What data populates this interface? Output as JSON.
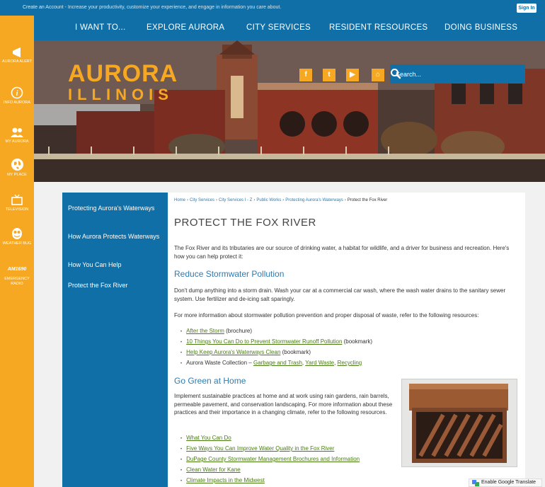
{
  "topbar": {
    "create_link": "Create an Account",
    "create_text": " - Increase your productivity, customize your experience, and engage in information you care about.",
    "signin": "Sign In"
  },
  "leftbar": {
    "items": [
      {
        "label": "AURORA ALERT",
        "icon": "megaphone-icon"
      },
      {
        "label": "INFO AURORA",
        "icon": "info-icon"
      },
      {
        "label": "MY AURORA",
        "icon": "people-icon"
      },
      {
        "label": "MY PLACE",
        "icon": "globe-icon"
      },
      {
        "label": "TELEVISION",
        "icon": "tv-icon"
      },
      {
        "label": "WEATHER BUG",
        "icon": "weatherbug-icon"
      },
      {
        "label": "EMERGENCY RADIO",
        "icon": "radio-icon",
        "logo_text": "AM1690"
      }
    ]
  },
  "nav": {
    "items": [
      "I WANT TO...",
      "EXPLORE AURORA",
      "CITY SERVICES",
      "RESIDENT RESOURCES",
      "DOING BUSINESS"
    ]
  },
  "hero": {
    "logo_line1": "AURORA",
    "logo_line2": "ILLINOIS",
    "social": [
      {
        "name": "facebook-icon",
        "glyph": "f"
      },
      {
        "name": "twitter-icon",
        "glyph": "t"
      },
      {
        "name": "youtube-icon",
        "glyph": "▶"
      },
      {
        "name": "home-icon",
        "glyph": "⌂"
      }
    ],
    "search_placeholder": "Search..."
  },
  "sidenav": {
    "items": [
      "Protecting Aurora's Waterways",
      "How Aurora Protects Waterways",
      "How You Can Help",
      "Protect the Fox River"
    ]
  },
  "breadcrumb": {
    "links": [
      "Home",
      "City Services",
      "City Services I - Z",
      "Public Works",
      "Protecting Aurora's Waterways"
    ],
    "current": "Protect the Fox River"
  },
  "main": {
    "title": "PROTECT THE FOX RIVER",
    "intro": "The Fox River and its tributaries are our source of drinking water, a habitat for wildlife, and a driver for business and recreation. Here's how you can help protect it:",
    "section1": {
      "heading": "Reduce Stormwater Pollution",
      "p1": "Don't dump anything into a storm drain. Wash your car at a commercial car wash, where the wash water drains to the sanitary sewer system. Use fertilizer and de-icing salt sparingly.",
      "p2": "For more information about stormwater pollution prevention and proper disposal of waste, refer to the following resources:",
      "links": [
        {
          "text": "After the Storm",
          "suffix": " (brochure)"
        },
        {
          "text": "10 Things You Can Do to Prevent Stormwater Runoff Pollution",
          "suffix": " (bookmark)"
        },
        {
          "text": "Help Keep Aurora's Waterways Clean",
          "suffix": " (bookmark)"
        }
      ],
      "waste": {
        "prefix": "Aurora Waste Collection – ",
        "links": [
          "Garbage and Trash",
          "Yard Waste",
          "Recycling"
        ]
      }
    },
    "section2": {
      "heading": "Go Green at Home",
      "p1": "Implement sustainable practices at home and at work using rain gardens, rain barrels, permeable pavement, and conservation landscaping. For more information about these practices and their importance in a changing climate, refer to the following resources.",
      "links": [
        "What You Can Do",
        "Five Ways You Can Improve Water Quality in the Fox River",
        "DuPage County Stormwater Management Brochures and Information",
        "Clean Water for Kane",
        "Climate Impacts in the Midwest"
      ]
    }
  },
  "translate": {
    "label": "Enable Google Translate"
  }
}
